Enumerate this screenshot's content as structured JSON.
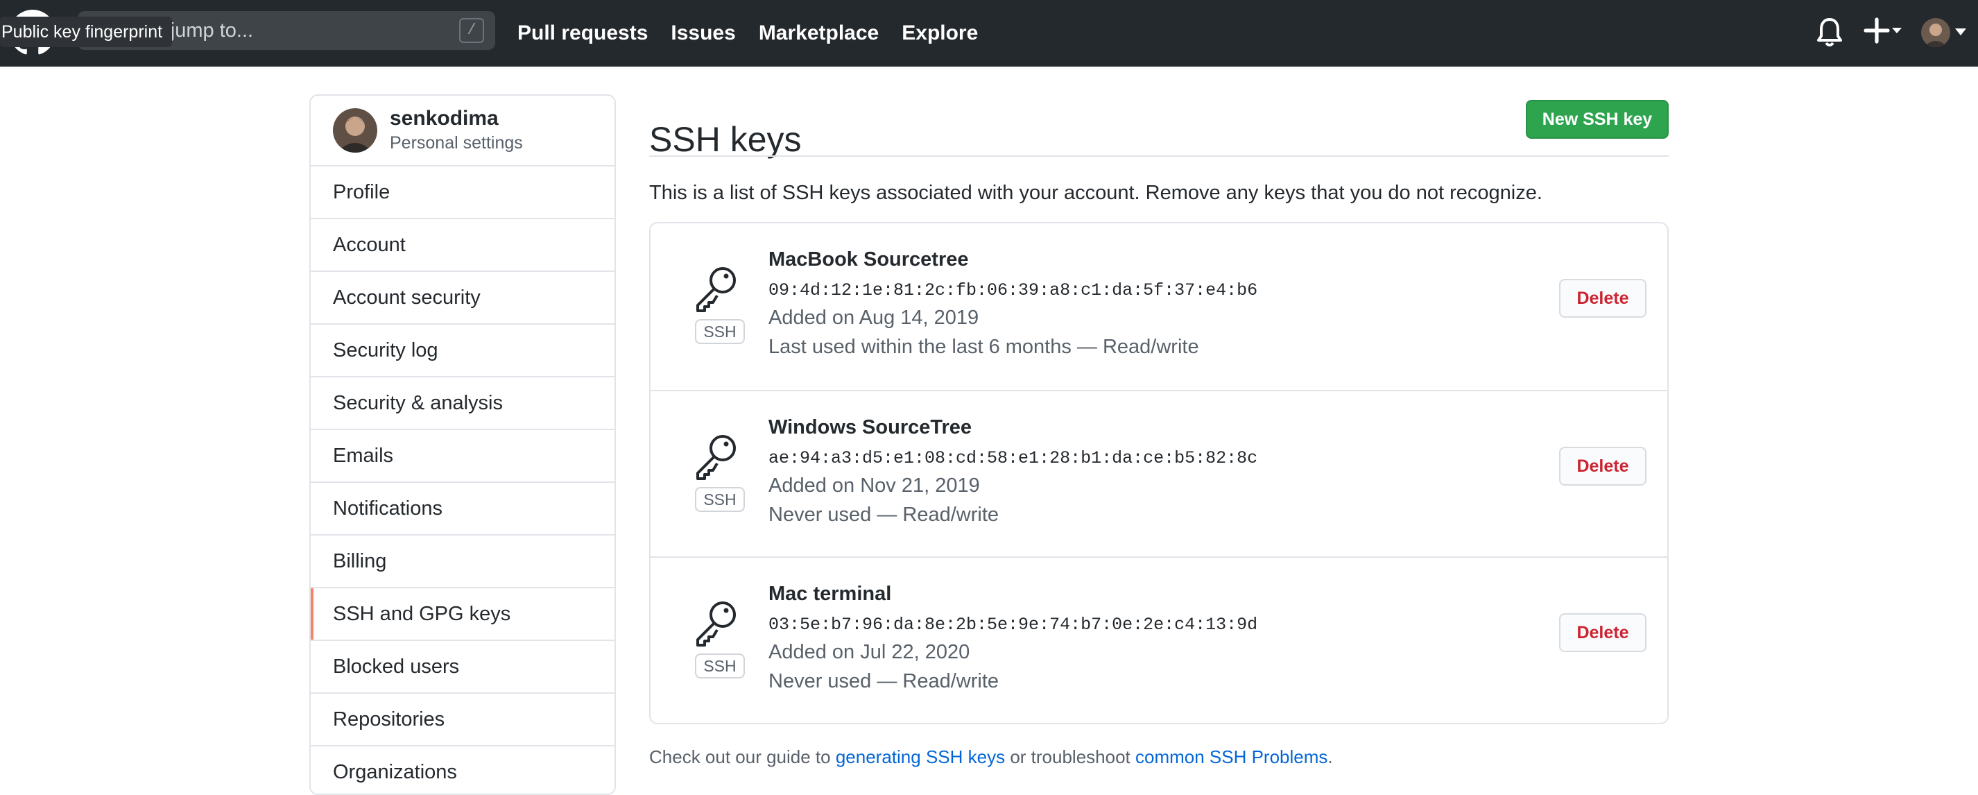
{
  "header": {
    "search_placeholder": "Search or jump to...",
    "slash_hint": "/",
    "tooltip": "Public key fingerprint",
    "nav": [
      "Pull requests",
      "Issues",
      "Marketplace",
      "Explore"
    ],
    "icons": [
      "github-logo-icon",
      "bell-icon",
      "plus-icon",
      "chevron-down-icon",
      "avatar"
    ]
  },
  "sidebar": {
    "username": "senkodima",
    "subtitle": "Personal settings",
    "items": [
      {
        "label": "Profile",
        "selected": false
      },
      {
        "label": "Account",
        "selected": false
      },
      {
        "label": "Account security",
        "selected": false
      },
      {
        "label": "Security log",
        "selected": false
      },
      {
        "label": "Security & analysis",
        "selected": false
      },
      {
        "label": "Emails",
        "selected": false
      },
      {
        "label": "Notifications",
        "selected": false
      },
      {
        "label": "Billing",
        "selected": false
      },
      {
        "label": "SSH and GPG keys",
        "selected": true
      },
      {
        "label": "Blocked users",
        "selected": false
      },
      {
        "label": "Repositories",
        "selected": false
      },
      {
        "label": "Organizations",
        "selected": false
      }
    ]
  },
  "main": {
    "title": "SSH keys",
    "new_key_label": "New SSH key",
    "intro": "This is a list of SSH keys associated with your account. Remove any keys that you do not recognize.",
    "keys": [
      {
        "badge": "SSH",
        "title": "MacBook Sourcetree",
        "fingerprint": "09:4d:12:1e:81:2c:fb:06:39:a8:c1:da:5f:37:e4:b6",
        "added": "Added on Aug 14, 2019",
        "usage": "Last used within the last 6 months — Read/write",
        "delete_label": "Delete"
      },
      {
        "badge": "SSH",
        "title": "Windows SourceTree",
        "fingerprint": "ae:94:a3:d5:e1:08:cd:58:e1:28:b1:da:ce:b5:82:8c",
        "added": "Added on Nov 21, 2019",
        "usage": "Never used — Read/write",
        "delete_label": "Delete"
      },
      {
        "badge": "SSH",
        "title": "Mac terminal",
        "fingerprint": "03:5e:b7:96:da:8e:2b:5e:9e:74:b7:0e:2e:c4:13:9d",
        "added": "Added on Jul 22, 2020",
        "usage": "Never used — Read/write",
        "delete_label": "Delete"
      }
    ],
    "footer": {
      "prefix": "Check out our guide to ",
      "link1": "generating SSH keys",
      "middle": " or troubleshoot ",
      "link2": "common SSH Problems",
      "suffix": "."
    }
  },
  "colors": {
    "header_bg": "#24292e",
    "primary_button": "#2ea44f",
    "danger_text": "#cb2431",
    "link": "#0366d6",
    "selected_marker": "#f9826c"
  }
}
